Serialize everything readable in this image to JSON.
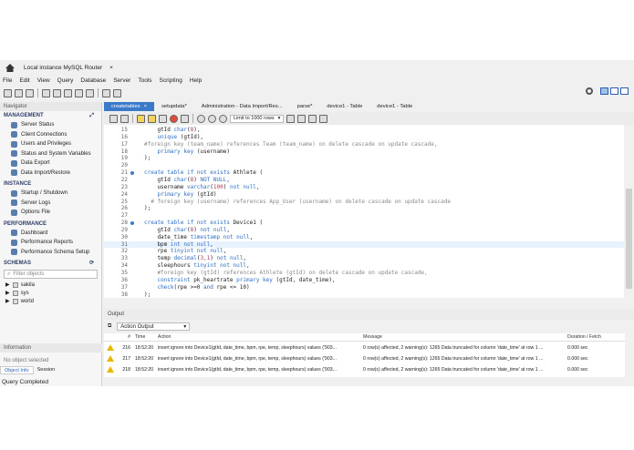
{
  "connection_tab": "Local instance MySQL Router",
  "menu": [
    "File",
    "Edit",
    "View",
    "Query",
    "Database",
    "Server",
    "Tools",
    "Scripting",
    "Help"
  ],
  "navigator": {
    "header": "Navigator",
    "management_title": "MANAGEMENT",
    "management": [
      "Server Status",
      "Client Connections",
      "Users and Privileges",
      "Status and System Variables",
      "Data Export",
      "Data Import/Restore"
    ],
    "instance_title": "INSTANCE",
    "instance": [
      "Startup / Shutdown",
      "Server Logs",
      "Options File"
    ],
    "performance_title": "PERFORMANCE",
    "performance": [
      "Dashboard",
      "Performance Reports",
      "Performance Schema Setup"
    ],
    "schemas_title": "SCHEMAS",
    "filter_placeholder": "Filter objects",
    "schemas": [
      "sakila",
      "sys",
      "world"
    ]
  },
  "information": {
    "header": "Information",
    "no_object": "No object selected",
    "tab_object": "Object Info",
    "tab_session": "Session"
  },
  "tabs": [
    "createtables",
    "setupdata*",
    "Administration - Data Import/Res...",
    "parse*",
    "device1 - Table",
    "device1 - Table"
  ],
  "limit": "Limit to 1000 rows",
  "editor_lines": [
    {
      "n": "15",
      "html": "    gtId char(8),"
    },
    {
      "n": "16",
      "html": "    unique (gtId),"
    },
    {
      "n": "17",
      "html": "#foreign key (team_name) references Team (team_name) on delete cascade on update cascade,"
    },
    {
      "n": "18",
      "html": "    primary key (username)"
    },
    {
      "n": "19",
      "html": ");"
    },
    {
      "n": "20",
      "html": ""
    },
    {
      "n": "21",
      "html": "create table if not exists Athlete (",
      "dot": true
    },
    {
      "n": "22",
      "html": "    gtId char(8) NOT NULL,"
    },
    {
      "n": "23",
      "html": "    username varchar(100) not null,"
    },
    {
      "n": "24",
      "html": "    primary key (gtId)"
    },
    {
      "n": "25",
      "html": "  # foreign key (username) references App_User (username) on delete cascade on update cascade"
    },
    {
      "n": "26",
      "html": ");"
    },
    {
      "n": "27",
      "html": ""
    },
    {
      "n": "28",
      "html": "create table if not exists Device1 (",
      "dot": true
    },
    {
      "n": "29",
      "html": "    gtId char(8) not null,"
    },
    {
      "n": "30",
      "html": "    date_time timestamp not null,"
    },
    {
      "n": "31",
      "html": "    bpm int not null,",
      "cur": true
    },
    {
      "n": "32",
      "html": "    rpe tinyint not null,"
    },
    {
      "n": "33",
      "html": "    temp decimal(3,1) not null,"
    },
    {
      "n": "34",
      "html": "    sleephours tinyint not null,"
    },
    {
      "n": "35",
      "html": "    #foreign key (gtId) references Athlete (gtId) on delete cascade on update cascade,"
    },
    {
      "n": "36",
      "html": "    constraint pk_heartrate primary key (gtId, date_time),"
    },
    {
      "n": "37",
      "html": "    check(rpe >=0 and rpe <= 10)"
    },
    {
      "n": "38",
      "html": ");"
    }
  ],
  "output": {
    "header": "Output",
    "selector": "Action Output",
    "columns": [
      "#",
      "Time",
      "Action",
      "Message",
      "Duration / Fetch"
    ],
    "rows": [
      {
        "num": "216",
        "time": "18:52:20",
        "action": "insert ignore into Device1(gtId, date_time, bpm, rpe, temp, sleephours) values ('903...",
        "message": "0 row(s) affected, 2 warning(s): 1265 Data truncated for column 'date_time' at row 1 ...",
        "duration": "0.000 sec"
      },
      {
        "num": "217",
        "time": "18:52:20",
        "action": "insert ignore into Device1(gtId, date_time, bpm, rpe, temp, sleephours) values ('903...",
        "message": "0 row(s) affected, 2 warning(s): 1265 Data truncated for column 'date_time' at row 1 ...",
        "duration": "0.000 sec"
      },
      {
        "num": "218",
        "time": "18:52:20",
        "action": "insert ignore into Device1(gtId, date_time, bpm, rpe, temp, sleephours) values ('903...",
        "message": "0 row(s) affected, 2 warning(s): 1265 Data truncated for column 'date_time' at row 1 ...",
        "duration": "0.000 sec"
      }
    ]
  },
  "status": "Query Completed"
}
